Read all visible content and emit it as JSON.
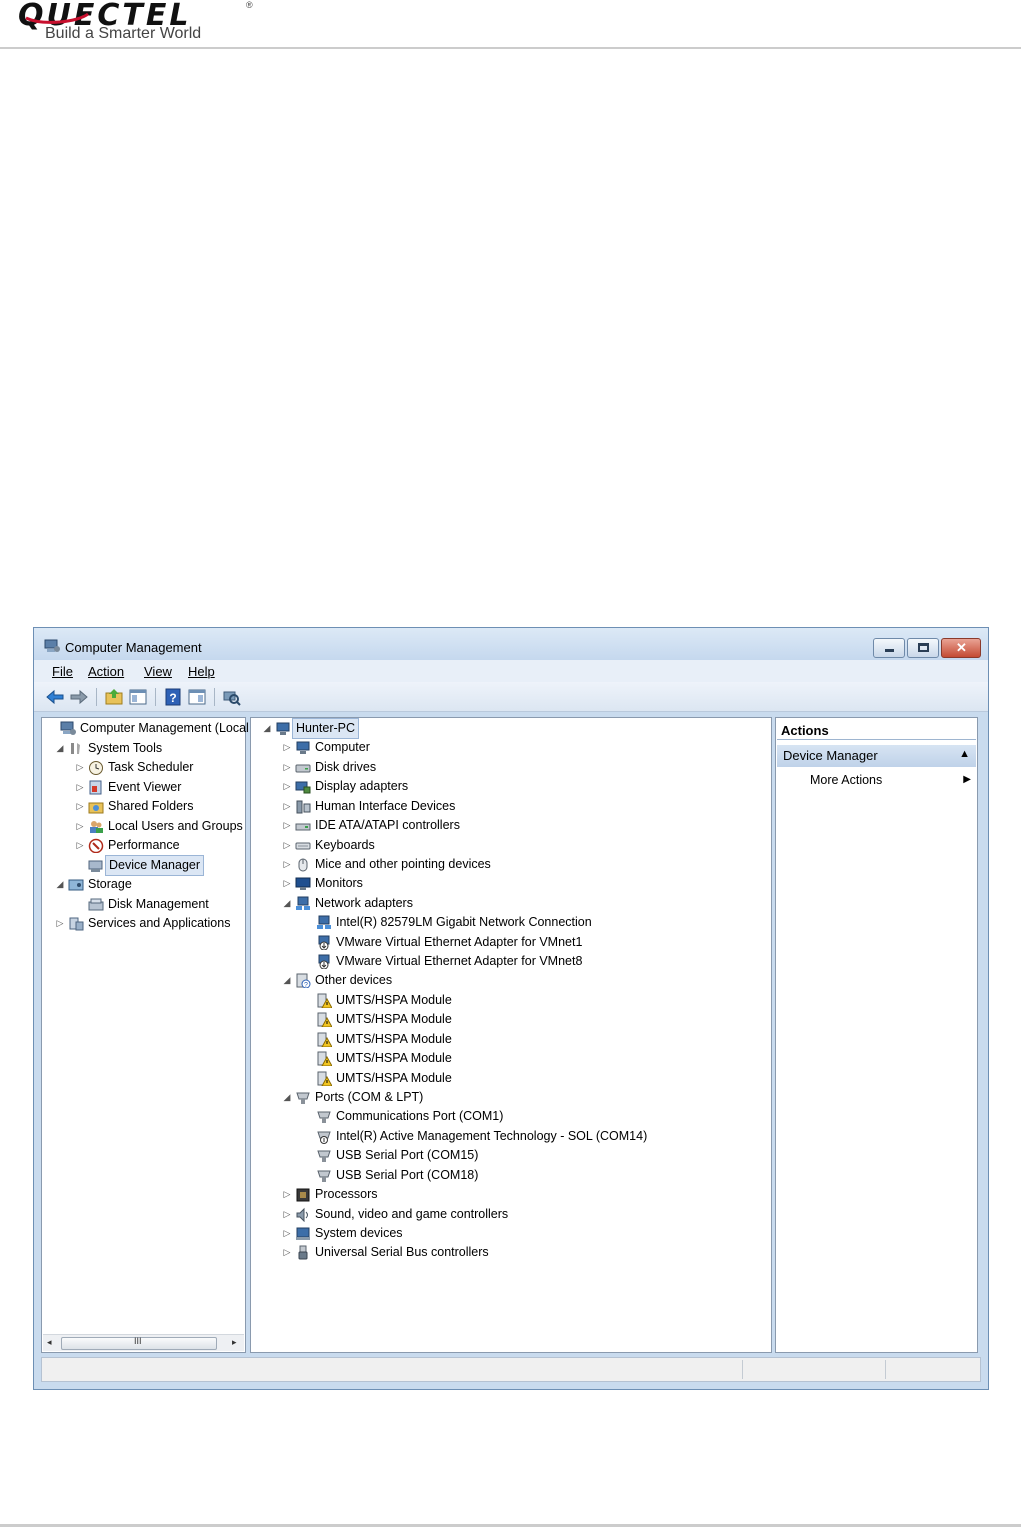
{
  "header": {
    "logo_word": "QUECTEL",
    "logo_mark": "®",
    "tagline": "Build a Smarter World"
  },
  "window": {
    "title": "Computer Management",
    "menu": [
      "File",
      "Action",
      "View",
      "Help"
    ],
    "toolbar_icons": [
      "back-arrow-icon",
      "forward-arrow-icon",
      "up-folder-icon",
      "show-hide-console-tree-icon",
      "help-icon",
      "show-hide-action-pane-icon",
      "scan-hardware-icon"
    ]
  },
  "left_tree": [
    {
      "label": "Computer Management (Local",
      "expander": "",
      "icon": "computer-management-icon"
    },
    {
      "label": "System Tools",
      "expander": "◢",
      "icon": "system-tools-icon"
    },
    {
      "label": "Task Scheduler",
      "expander": "▷",
      "icon": "clock-icon"
    },
    {
      "label": "Event Viewer",
      "expander": "▷",
      "icon": "event-viewer-icon"
    },
    {
      "label": "Shared Folders",
      "expander": "▷",
      "icon": "shared-folders-icon"
    },
    {
      "label": "Local Users and Groups",
      "expander": "▷",
      "icon": "users-icon"
    },
    {
      "label": "Performance",
      "expander": "▷",
      "icon": "performance-icon"
    },
    {
      "label": "Device Manager",
      "expander": "",
      "icon": "device-manager-icon"
    },
    {
      "label": "Storage",
      "expander": "◢",
      "icon": "storage-icon"
    },
    {
      "label": "Disk Management",
      "expander": "",
      "icon": "disk-management-icon"
    },
    {
      "label": "Services and Applications",
      "expander": "▷",
      "icon": "services-icon"
    }
  ],
  "scrollbar": {
    "left_arrow": "◂",
    "thumb_grip": "III",
    "right_arrow": "▸"
  },
  "device_tree": [
    {
      "label": "Hunter-PC",
      "expander": "◢",
      "icon": "computer-icon"
    },
    {
      "label": "Computer",
      "expander": "▷",
      "icon": "computer-icon"
    },
    {
      "label": "Disk drives",
      "expander": "▷",
      "icon": "disk-drive-icon"
    },
    {
      "label": "Display adapters",
      "expander": "▷",
      "icon": "display-adapter-icon"
    },
    {
      "label": "Human Interface Devices",
      "expander": "▷",
      "icon": "hid-icon"
    },
    {
      "label": "IDE ATA/ATAPI controllers",
      "expander": "▷",
      "icon": "ide-controller-icon"
    },
    {
      "label": "Keyboards",
      "expander": "▷",
      "icon": "keyboard-icon"
    },
    {
      "label": "Mice and other pointing devices",
      "expander": "▷",
      "icon": "mouse-icon"
    },
    {
      "label": "Monitors",
      "expander": "▷",
      "icon": "monitor-icon"
    },
    {
      "label": "Network adapters",
      "expander": "◢",
      "icon": "network-adapter-icon"
    },
    {
      "label": "Intel(R) 82579LM Gigabit Network Connection",
      "expander": "",
      "icon": "network-adapter-icon"
    },
    {
      "label": "VMware Virtual Ethernet Adapter for VMnet1",
      "expander": "",
      "icon": "network-adapter-disabled-icon"
    },
    {
      "label": "VMware Virtual Ethernet Adapter for VMnet8",
      "expander": "",
      "icon": "network-adapter-disabled-icon"
    },
    {
      "label": "Other devices",
      "expander": "◢",
      "icon": "unknown-device-icon"
    },
    {
      "label": "UMTS/HSPA Module",
      "expander": "",
      "icon": "warning-device-icon"
    },
    {
      "label": "UMTS/HSPA Module",
      "expander": "",
      "icon": "warning-device-icon"
    },
    {
      "label": "UMTS/HSPA Module",
      "expander": "",
      "icon": "warning-device-icon"
    },
    {
      "label": "UMTS/HSPA Module",
      "expander": "",
      "icon": "warning-device-icon"
    },
    {
      "label": "UMTS/HSPA Module",
      "expander": "",
      "icon": "warning-device-icon"
    },
    {
      "label": "Ports (COM & LPT)",
      "expander": "◢",
      "icon": "port-icon"
    },
    {
      "label": "Communications Port (COM1)",
      "expander": "",
      "icon": "port-icon"
    },
    {
      "label": "Intel(R) Active Management Technology - SOL (COM14)",
      "expander": "",
      "icon": "port-disabled-icon"
    },
    {
      "label": "USB Serial Port (COM15)",
      "expander": "",
      "icon": "port-icon"
    },
    {
      "label": "USB Serial Port (COM18)",
      "expander": "",
      "icon": "port-icon"
    },
    {
      "label": "Processors",
      "expander": "▷",
      "icon": "processor-icon"
    },
    {
      "label": "Sound, video and game controllers",
      "expander": "▷",
      "icon": "sound-icon"
    },
    {
      "label": "System devices",
      "expander": "▷",
      "icon": "system-devices-icon"
    },
    {
      "label": "Universal Serial Bus controllers",
      "expander": "▷",
      "icon": "usb-icon"
    }
  ],
  "actions": {
    "heading": "Actions",
    "section": "Device Manager",
    "section_toggle": "▲",
    "item": "More Actions",
    "item_arrow": "▶"
  },
  "caption_buttons": {
    "close_glyph": "✕"
  }
}
